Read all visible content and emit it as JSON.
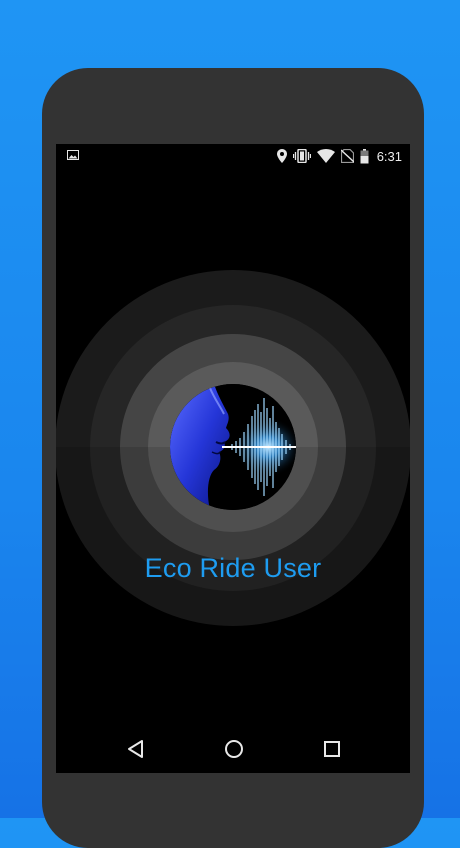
{
  "status_bar": {
    "time": "6:31",
    "icons": [
      "image-notification-icon",
      "location-icon",
      "vibrate-icon",
      "wifi-icon",
      "no-sim-icon",
      "battery-icon"
    ]
  },
  "splash": {
    "app_name": "Eco Ride User",
    "logo": "voice-face-sound-wave-logo"
  },
  "nav_bar": {
    "buttons": [
      "back-icon",
      "home-icon",
      "recents-icon"
    ]
  },
  "colors": {
    "background_blue": "#1f95f4",
    "title_blue": "#1e9cf0",
    "phone_frame": "#333333",
    "screen": "#000000"
  }
}
